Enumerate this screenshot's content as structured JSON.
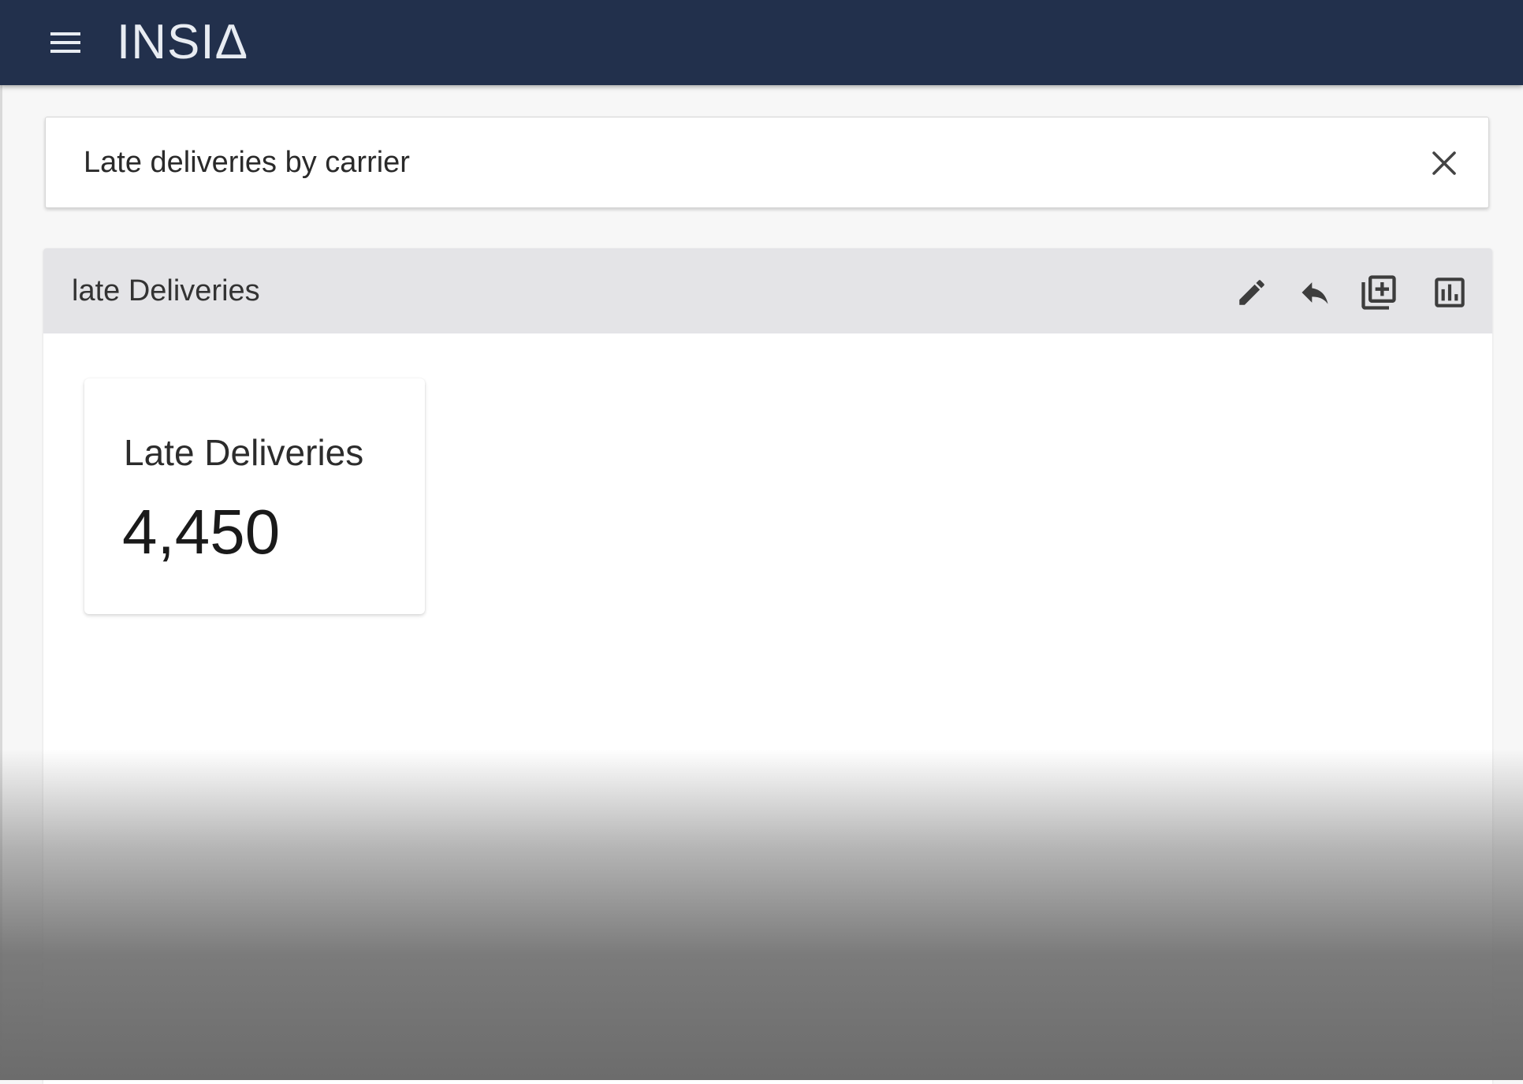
{
  "app": {
    "logo_text": "INSIΔ",
    "menu_icon": "hamburger-menu-icon",
    "brand_color": "#22304c"
  },
  "search": {
    "value": "Late deliveries by carrier",
    "clear_icon": "close-icon"
  },
  "panel": {
    "title": "late Deliveries",
    "actions": [
      {
        "name": "edit",
        "icon": "pencil-icon"
      },
      {
        "name": "reply",
        "icon": "reply-arrow-icon"
      },
      {
        "name": "add-to-dashboard",
        "icon": "add-box-icon"
      },
      {
        "name": "change-chart",
        "icon": "bar-chart-icon"
      }
    ]
  },
  "kpi": {
    "label": "Late Deliveries",
    "value": "4,450"
  }
}
